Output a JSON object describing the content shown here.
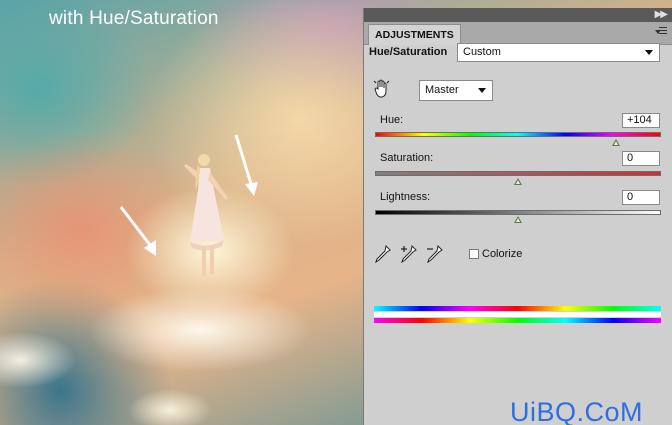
{
  "image": {
    "caption": "with Hue/Saturation"
  },
  "panel": {
    "tab_label": "ADJUSTMENTS",
    "adjustment_name": "Hue/Saturation",
    "preset_value": "Custom",
    "channel_value": "Master",
    "hue": {
      "label": "Hue:",
      "value": "+104",
      "slider_position": 0.79
    },
    "saturation": {
      "label": "Saturation:",
      "value": "0",
      "slider_position": 0.5
    },
    "lightness": {
      "label": "Lightness:",
      "value": "0",
      "slider_position": 0.5
    },
    "colorize_label": "Colorize",
    "colorize_checked": false
  },
  "watermark": "UiBQ.CoM",
  "colors": {
    "panel_bg": "#cfcfcf",
    "watermark": "#2e6fe0",
    "thumb": "#5f7a4c"
  },
  "icons": [
    "targeted-adjustment-hand-icon",
    "eyedropper-icon",
    "eyedropper-plus-icon",
    "eyedropper-minus-icon",
    "panel-menu-icon",
    "dropdown-caret-icon"
  ]
}
